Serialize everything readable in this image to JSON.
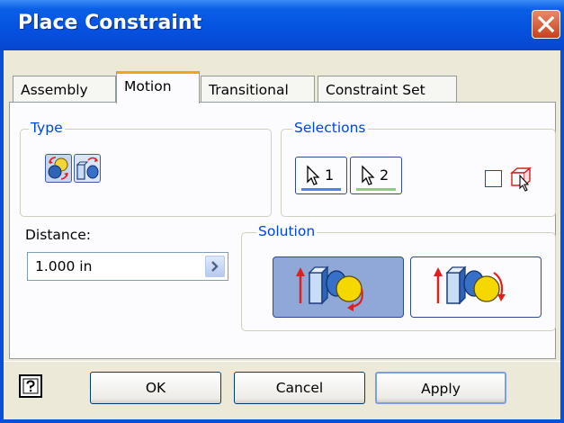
{
  "window": {
    "title": "Place Constraint",
    "close_icon": "close-icon"
  },
  "tabs": [
    {
      "label": "Assembly"
    },
    {
      "label": "Motion"
    },
    {
      "label": "Transitional"
    },
    {
      "label": "Constraint Set"
    }
  ],
  "active_tab": "Motion",
  "type_group": {
    "label": "Type",
    "buttons": [
      {
        "icon": "rotation-type-icon"
      },
      {
        "icon": "rotation-translation-type-icon"
      }
    ]
  },
  "selections_group": {
    "label": "Selections",
    "first": {
      "label": "1",
      "icon": "cursor-arrow-icon",
      "color": "#4a86e8"
    },
    "second": {
      "label": "2",
      "icon": "cursor-arrow-icon",
      "color": "#8ccf7e"
    },
    "pick_part_first_checked": false,
    "pick_part_icon": "pick-part-first-icon"
  },
  "distance": {
    "label": "Distance:",
    "value": "1.000 in"
  },
  "solution_group": {
    "label": "Solution",
    "options": [
      {
        "icon": "forward-solution-icon",
        "selected": true
      },
      {
        "icon": "reverse-solution-icon",
        "selected": false
      }
    ]
  },
  "footer": {
    "help_icon": "help-icon",
    "ok": "OK",
    "cancel": "Cancel",
    "apply": "Apply"
  }
}
